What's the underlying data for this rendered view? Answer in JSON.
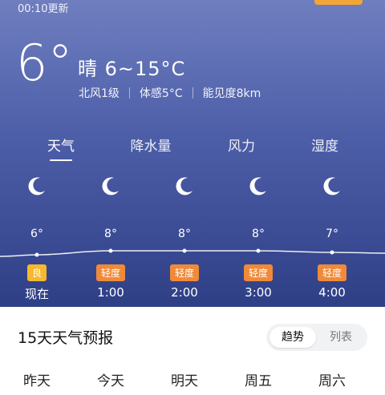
{
  "header": {
    "update_time": "00:10更新",
    "temperature": "6°",
    "condition": "晴  6~15°C",
    "stats": [
      "北风1级",
      "体感5°C",
      "能见度8km"
    ]
  },
  "tabs": [
    {
      "label": "天气"
    },
    {
      "label": "降水量"
    },
    {
      "label": "风力"
    },
    {
      "label": "湿度"
    }
  ],
  "hourly": [
    {
      "time": "现在",
      "temp": "6°",
      "aqi": "良",
      "aqi_color": "#f5b82e",
      "icon": "moon-icon"
    },
    {
      "time": "1:00",
      "temp": "8°",
      "aqi": "轻度",
      "aqi_color": "#f08a3a",
      "icon": "moon-icon"
    },
    {
      "time": "2:00",
      "temp": "8°",
      "aqi": "轻度",
      "aqi_color": "#f08a3a",
      "icon": "moon-icon"
    },
    {
      "time": "3:00",
      "temp": "8°",
      "aqi": "轻度",
      "aqi_color": "#f08a3a",
      "icon": "moon-icon"
    },
    {
      "time": "4:00",
      "temp": "7°",
      "aqi": "轻度",
      "aqi_color": "#f08a3a",
      "icon": "moon-icon"
    }
  ],
  "forecast": {
    "title": "15天天气预报",
    "toggle": [
      "趋势",
      "列表"
    ],
    "days": [
      "昨天",
      "今天",
      "明天",
      "周五",
      "周六"
    ]
  }
}
